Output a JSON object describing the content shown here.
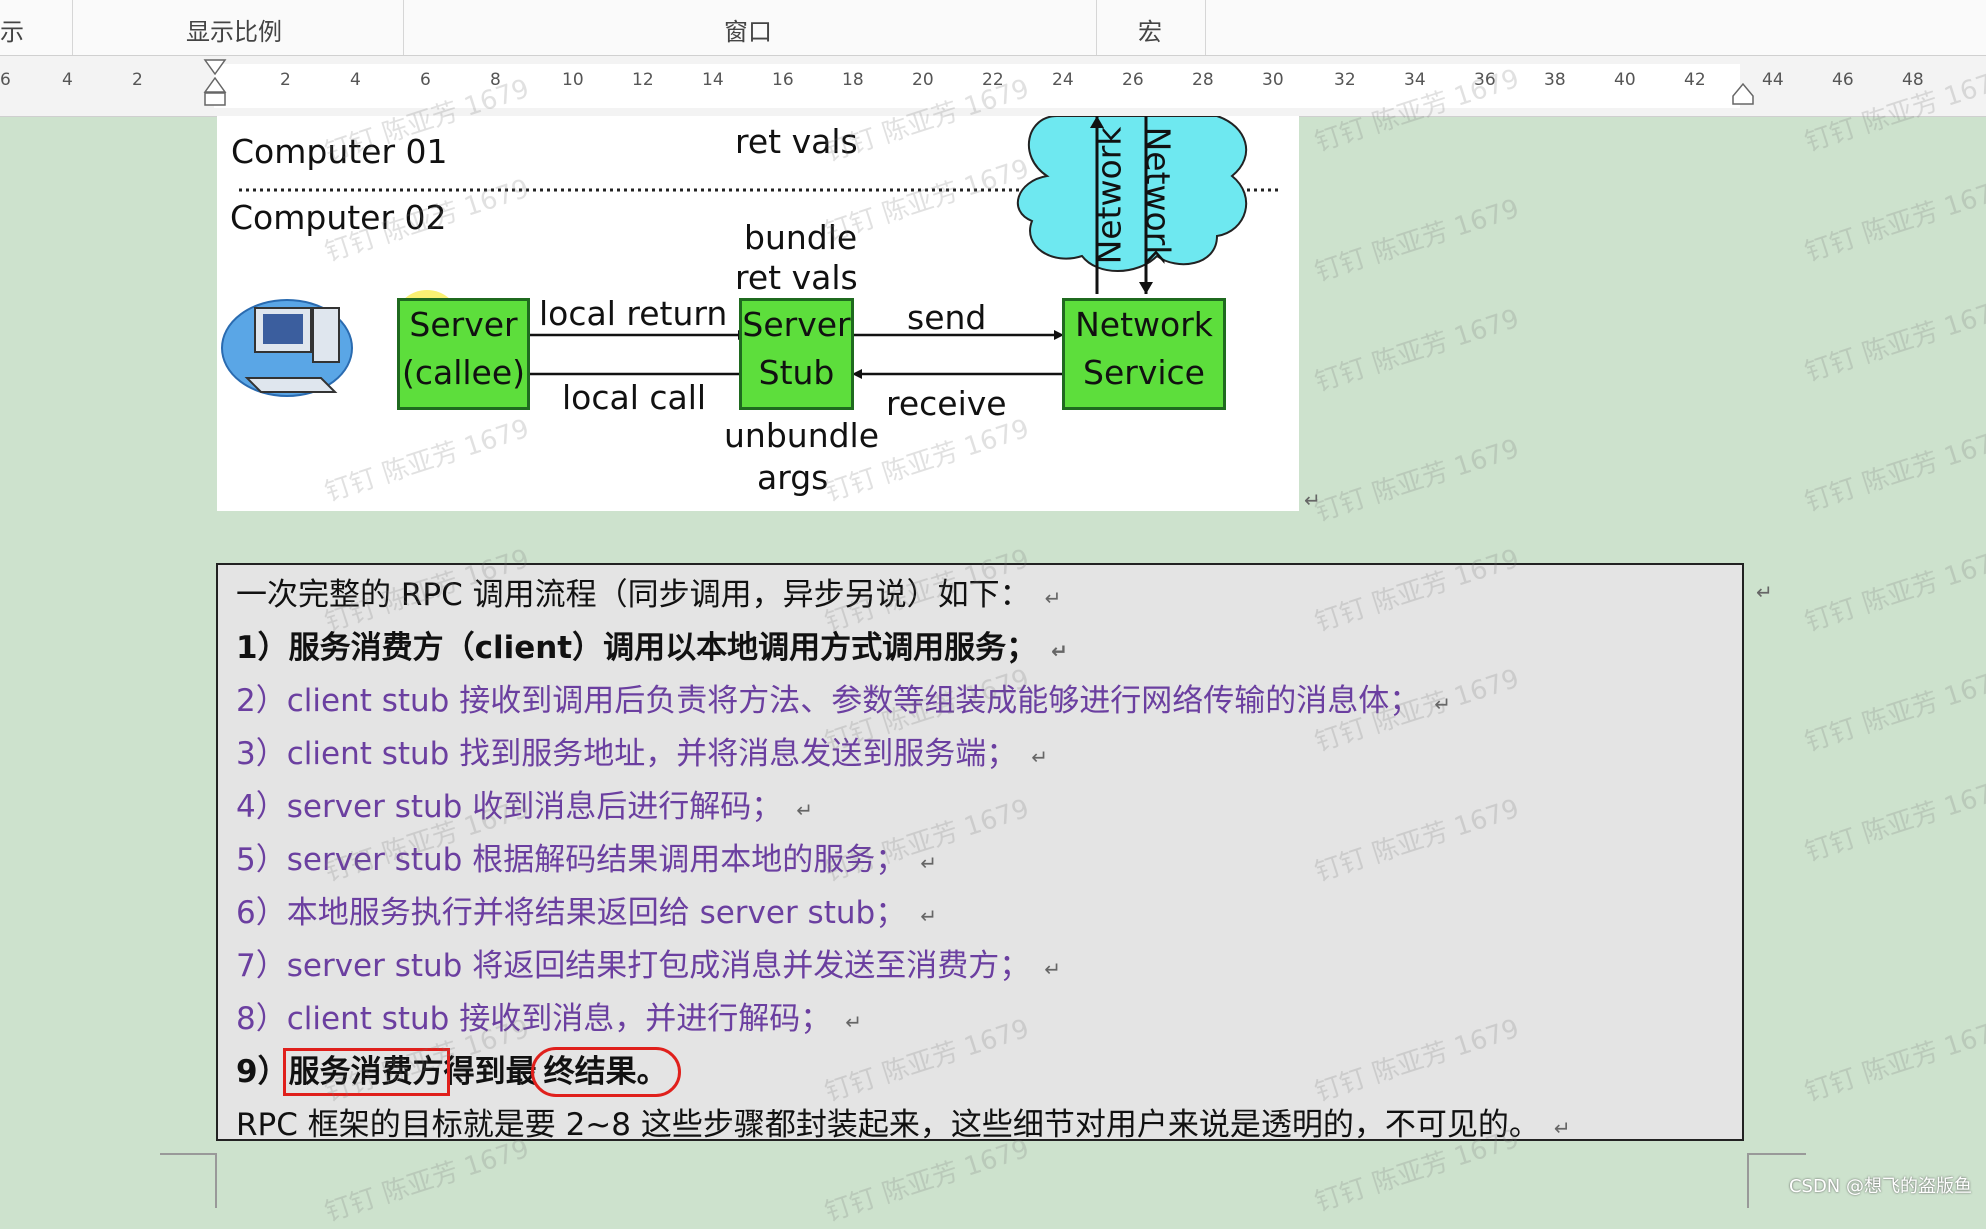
{
  "ribbon": {
    "groups": [
      "示",
      "显示比例",
      "窗口",
      "宏"
    ]
  },
  "ruler": {
    "ticks": [
      "6",
      "4",
      "2",
      "2",
      "4",
      "6",
      "8",
      "10",
      "12",
      "14",
      "16",
      "18",
      "20",
      "22",
      "24",
      "26",
      "28",
      "30",
      "32",
      "34",
      "36",
      "38",
      "40",
      "42",
      "44",
      "46",
      "48"
    ]
  },
  "diagram": {
    "computer1": "Computer 01",
    "computer2": "Computer 02",
    "ret_vals_top": "ret vals",
    "bundle": "bundle",
    "ret_vals": "ret vals",
    "local_return": "local return",
    "local_call": "local call",
    "send": "send",
    "receive": "receive",
    "unbundle": "unbundle",
    "args": "args",
    "server_line1": "Server",
    "server_line2": "(callee)",
    "stub_line1": "Server",
    "stub_line2": "Stub",
    "netsvc_line1": "Network",
    "netsvc_line2": "Service",
    "network_a": "Network",
    "network_b": "Network",
    "colors": {
      "box": "#5dde3c",
      "cloud": "#6ee8f0"
    }
  },
  "textbox": {
    "intro": "一次完整的 RPC 调用流程（同步调用，异步另说）如下：",
    "step1": "1）服务消费方（client）调用以本地调用方式调用服务；",
    "step2": "2）client stub 接收到调用后负责将方法、参数等组装成能够进行网络传输的消息体；",
    "step3": "3）client stub 找到服务地址，并将消息发送到服务端；",
    "step4": "4）server stub 收到消息后进行解码；",
    "step5": "5）server stub 根据解码结果调用本地的服务；",
    "step6": "6）本地服务执行并将结果返回给 server stub；",
    "step7": "7）server stub 将返回结果打包成消息并发送至消费方；",
    "step8": "8）client stub 接收到消息，并进行解码；",
    "step9_num": "9）",
    "step9_a": "服务消费方",
    "step9_b": "得到最",
    "step9_c": "终结果。",
    "summary": "RPC 框架的目标就是要 2~8 这些步骤都封装起来，这些细节对用户来说是透明的，不可见的。",
    "return_mark": "↵",
    "colors": {
      "purple": "#6b3fa0",
      "annotation": "#e0201c"
    }
  },
  "watermark": "钉钉 陈亚芳 1679",
  "footer": "CSDN @想飞的盗版鱼"
}
